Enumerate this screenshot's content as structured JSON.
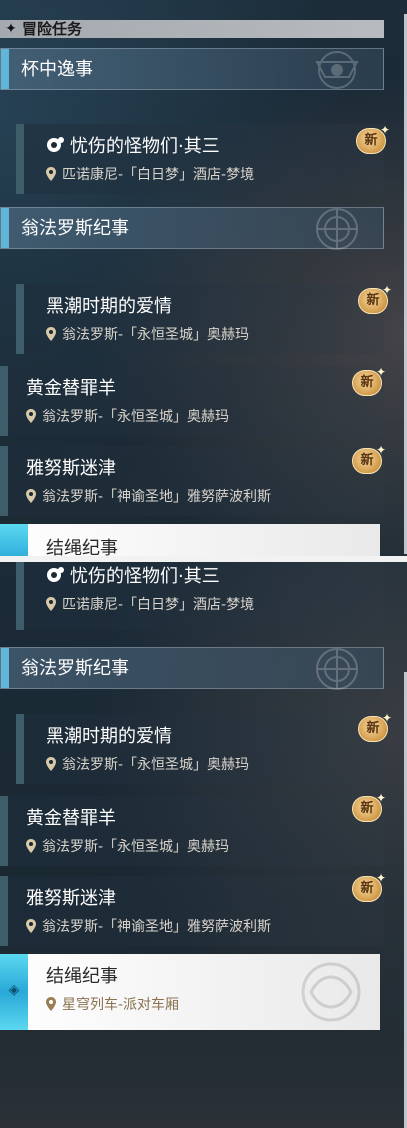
{
  "header": {
    "title": "冒险任务"
  },
  "groups": {
    "cup": "杯中逸事",
    "okhema": "翁法罗斯纪事",
    "knot": "结绳纪事"
  },
  "quests": {
    "monsters": {
      "title": "忧伤的怪物们·其三",
      "location": "匹诺康尼-「白日梦」酒店-梦境"
    },
    "tidal": {
      "title": "黑潮时期的爱情",
      "location": "翁法罗斯-「永恒圣城」奥赫玛"
    },
    "scapegoat": {
      "title": "黄金替罪羊",
      "location": "翁法罗斯-「永恒圣城」奥赫玛"
    },
    "janus": {
      "title": "雅努斯迷津",
      "location": "翁法罗斯-「神谕圣地」雅努萨波利斯"
    },
    "knot": {
      "title": "结绳纪事",
      "location": "星穹列车-派对车厢"
    }
  },
  "badge": {
    "label": "新"
  },
  "colors": {
    "accent": "#5fb6d8",
    "badge": "#d19a48",
    "selected_bg": "#ffffff"
  },
  "icons": [
    "diamond-icon",
    "location-pin-icon",
    "special-quest-icon",
    "new-badge-icon",
    "emblem-icon"
  ]
}
